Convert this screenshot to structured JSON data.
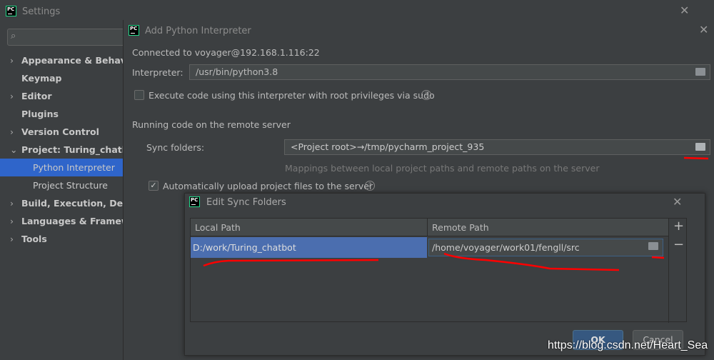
{
  "settings": {
    "title": "Settings",
    "search_placeholder": "",
    "sidebar": [
      {
        "label": "Appearance & Behavior",
        "expandable": true
      },
      {
        "label": "Keymap",
        "expandable": false
      },
      {
        "label": "Editor",
        "expandable": true
      },
      {
        "label": "Plugins",
        "expandable": false
      },
      {
        "label": "Version Control",
        "expandable": true
      },
      {
        "label": "Project: Turing_chatbot",
        "expandable": true,
        "expanded": true
      },
      {
        "label": "Python Interpreter",
        "selected": true
      },
      {
        "label": "Project Structure"
      },
      {
        "label": "Build, Execution, Deployment",
        "expandable": true
      },
      {
        "label": "Languages & Frameworks",
        "expandable": true
      },
      {
        "label": "Tools",
        "expandable": true
      }
    ]
  },
  "add_interpreter": {
    "title": "Add Python Interpreter",
    "connected": "Connected to voyager@192.168.1.116:22",
    "interpreter_label": "Interpreter:",
    "interpreter_value": "/usr/bin/python3.8",
    "sudo_label": "Execute code using this interpreter with root privileges via sudo",
    "sudo_checked": false,
    "section": "Running code on the remote server",
    "sync_label": "Sync folders:",
    "sync_value": "<Project root>→/tmp/pycharm_project_935",
    "sync_hint": "Mappings between local project paths and remote paths on the server",
    "auto_upload_label": "Automatically upload project files to the server",
    "auto_upload_checked": true
  },
  "edit_sync": {
    "title": "Edit Sync Folders",
    "columns": [
      "Local Path",
      "Remote Path"
    ],
    "rows": [
      {
        "local": "D:/work/Turing_chatbot",
        "remote": "/home/voyager/work01/fengll/src"
      }
    ],
    "add": "+",
    "remove": "−",
    "ok": "OK",
    "cancel": "Cancel"
  },
  "watermark": "https://blog.csdn.net/Heart_Sea",
  "colors": {
    "accent": "#2f65ca",
    "selection": "#4b6eaf",
    "annotation": "#ff0000"
  }
}
